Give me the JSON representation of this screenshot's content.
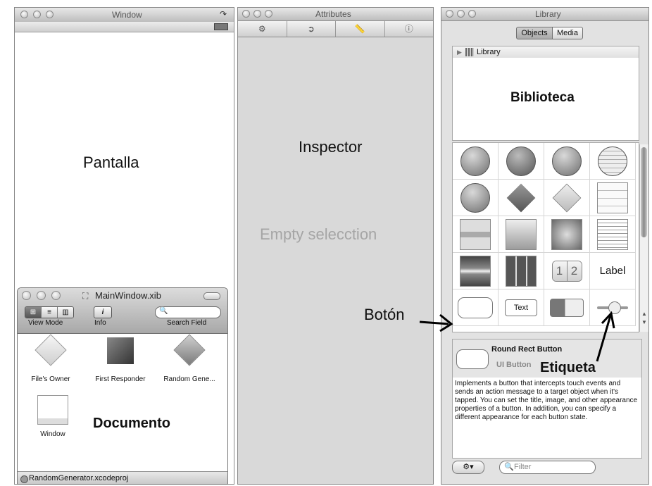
{
  "window_panel": {
    "title": "Window",
    "canvas_label": "Pantalla"
  },
  "inspector_panel": {
    "title": "Attributes",
    "heading": "Inspector",
    "empty_text": "Empty selecction",
    "tab_icons": [
      "identity-icon",
      "connections-icon",
      "size-ruler-icon",
      "info-icon"
    ]
  },
  "library_panel": {
    "title": "Library",
    "tabs": [
      "Objects",
      "Media"
    ],
    "tree_item": "Library",
    "area_label": "Biblioteca",
    "grid_texts": {
      "label": "Label",
      "text_field": "Text",
      "segment_1": "1",
      "segment_2": "2"
    },
    "detail": {
      "name": "Round Rect Button",
      "class": "UI Button",
      "description": "Implements a button that intercepts touch events and sends an action message to a target object when it's tapped. You can set the title, image, and other appearance properties of a button. In addition, you can specify a different appearance for each button state."
    },
    "filter_placeholder": "Filter"
  },
  "document_panel": {
    "title": "MainWindow.xib",
    "toolbar": {
      "view_mode_label": "View Mode",
      "info_label": "Info",
      "search_label": "Search Field"
    },
    "items": [
      "File's Owner",
      "First Responder",
      "Random Gene...",
      "Window"
    ],
    "area_label": "Documento",
    "status": "RandomGenerator.xcodeproj"
  },
  "annotations": {
    "button_label": "Botón",
    "label_label": "Etiqueta"
  }
}
